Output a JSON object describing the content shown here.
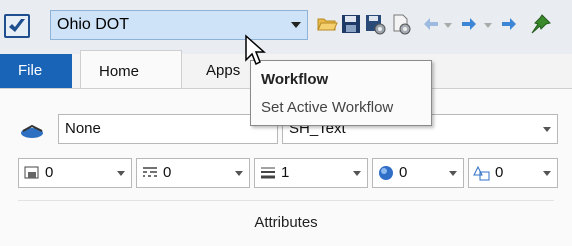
{
  "qat": {
    "workflow_value": "Ohio DOT",
    "icons": [
      "open-folder-icon",
      "save-icon",
      "save-settings-icon",
      "file-properties-icon",
      "undo-icon",
      "undo-dropdown-icon",
      "redo-icon",
      "pin-icon"
    ]
  },
  "tabs": [
    {
      "label": "File"
    },
    {
      "label": "Home"
    },
    {
      "label": "Apps"
    }
  ],
  "attributes": {
    "level_value": "None",
    "text_style_value": "SH_Text",
    "color_value": "0",
    "line_style_value": "0",
    "weight_value": "1",
    "transparency_value": "0",
    "class_value": "0",
    "group_label": "Attributes"
  },
  "tooltip": {
    "title": "Workflow",
    "description": "Set Active Workflow"
  },
  "colors": {
    "file_tab": "#1a64b8",
    "workflow_highlight": "#cfe3f8",
    "save_icon": "#1e3a66",
    "pin_icon": "#3a8a2a"
  }
}
